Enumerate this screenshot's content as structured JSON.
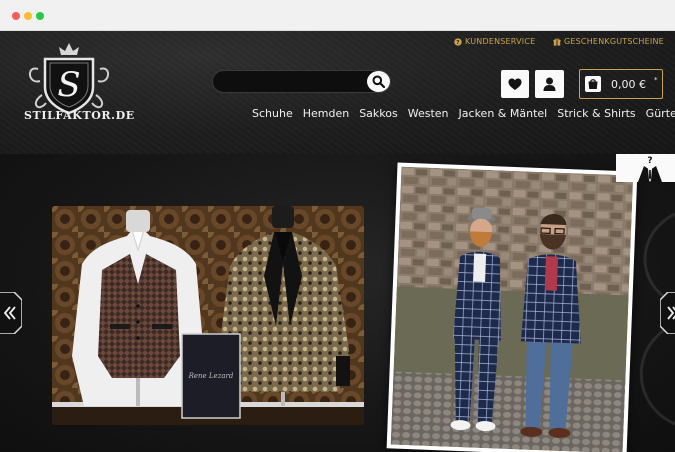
{
  "browser": {
    "controls": [
      "close",
      "minimize",
      "maximize"
    ]
  },
  "header": {
    "links": {
      "service": "KUNDENSERVICE",
      "gift": "GESCHENKGUTSCHEINE"
    },
    "logo_name": "STILFAKTOR.DE",
    "search": {
      "placeholder": "",
      "value": ""
    },
    "cart_total": "0,00 €",
    "cart_note": "*",
    "nav": [
      "Schuhe",
      "Hemden",
      "Sakkos",
      "Westen",
      "Jacken & Mäntel",
      "Strick & Shirts",
      "Gürtel"
    ],
    "colors": {
      "accent": "#c9a24a",
      "background": "#1e1e1e",
      "text": "#f0f0f0"
    }
  },
  "hero": {
    "slides": [
      "suits-on-mannequins",
      "two-men-in-checked-suits"
    ],
    "box_brand": "Rene Lezard"
  },
  "icons": {
    "service": "question-circle-icon",
    "gift": "gift-icon",
    "search": "search-icon",
    "wishlist": "heart-icon",
    "account": "user-icon",
    "cart": "shopping-bag-icon",
    "style_advisor": "tie-question-icon",
    "prev": "chevron-double-left-icon",
    "next": "chevron-double-right-icon"
  }
}
